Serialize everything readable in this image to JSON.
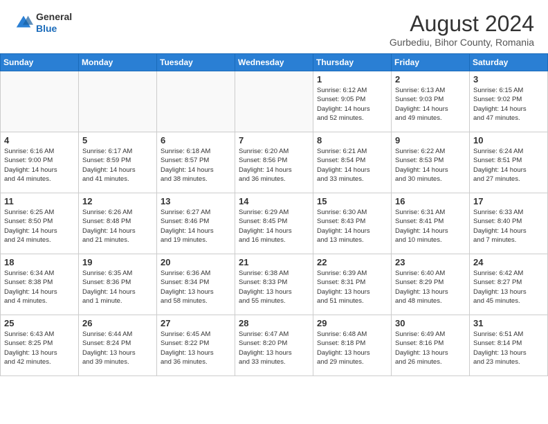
{
  "header": {
    "logo_general": "General",
    "logo_blue": "Blue",
    "month_year": "August 2024",
    "location": "Gurbediu, Bihor County, Romania"
  },
  "weekdays": [
    "Sunday",
    "Monday",
    "Tuesday",
    "Wednesday",
    "Thursday",
    "Friday",
    "Saturday"
  ],
  "weeks": [
    [
      {
        "day": "",
        "info": ""
      },
      {
        "day": "",
        "info": ""
      },
      {
        "day": "",
        "info": ""
      },
      {
        "day": "",
        "info": ""
      },
      {
        "day": "1",
        "info": "Sunrise: 6:12 AM\nSunset: 9:05 PM\nDaylight: 14 hours\nand 52 minutes."
      },
      {
        "day": "2",
        "info": "Sunrise: 6:13 AM\nSunset: 9:03 PM\nDaylight: 14 hours\nand 49 minutes."
      },
      {
        "day": "3",
        "info": "Sunrise: 6:15 AM\nSunset: 9:02 PM\nDaylight: 14 hours\nand 47 minutes."
      }
    ],
    [
      {
        "day": "4",
        "info": "Sunrise: 6:16 AM\nSunset: 9:00 PM\nDaylight: 14 hours\nand 44 minutes."
      },
      {
        "day": "5",
        "info": "Sunrise: 6:17 AM\nSunset: 8:59 PM\nDaylight: 14 hours\nand 41 minutes."
      },
      {
        "day": "6",
        "info": "Sunrise: 6:18 AM\nSunset: 8:57 PM\nDaylight: 14 hours\nand 38 minutes."
      },
      {
        "day": "7",
        "info": "Sunrise: 6:20 AM\nSunset: 8:56 PM\nDaylight: 14 hours\nand 36 minutes."
      },
      {
        "day": "8",
        "info": "Sunrise: 6:21 AM\nSunset: 8:54 PM\nDaylight: 14 hours\nand 33 minutes."
      },
      {
        "day": "9",
        "info": "Sunrise: 6:22 AM\nSunset: 8:53 PM\nDaylight: 14 hours\nand 30 minutes."
      },
      {
        "day": "10",
        "info": "Sunrise: 6:24 AM\nSunset: 8:51 PM\nDaylight: 14 hours\nand 27 minutes."
      }
    ],
    [
      {
        "day": "11",
        "info": "Sunrise: 6:25 AM\nSunset: 8:50 PM\nDaylight: 14 hours\nand 24 minutes."
      },
      {
        "day": "12",
        "info": "Sunrise: 6:26 AM\nSunset: 8:48 PM\nDaylight: 14 hours\nand 21 minutes."
      },
      {
        "day": "13",
        "info": "Sunrise: 6:27 AM\nSunset: 8:46 PM\nDaylight: 14 hours\nand 19 minutes."
      },
      {
        "day": "14",
        "info": "Sunrise: 6:29 AM\nSunset: 8:45 PM\nDaylight: 14 hours\nand 16 minutes."
      },
      {
        "day": "15",
        "info": "Sunrise: 6:30 AM\nSunset: 8:43 PM\nDaylight: 14 hours\nand 13 minutes."
      },
      {
        "day": "16",
        "info": "Sunrise: 6:31 AM\nSunset: 8:41 PM\nDaylight: 14 hours\nand 10 minutes."
      },
      {
        "day": "17",
        "info": "Sunrise: 6:33 AM\nSunset: 8:40 PM\nDaylight: 14 hours\nand 7 minutes."
      }
    ],
    [
      {
        "day": "18",
        "info": "Sunrise: 6:34 AM\nSunset: 8:38 PM\nDaylight: 14 hours\nand 4 minutes."
      },
      {
        "day": "19",
        "info": "Sunrise: 6:35 AM\nSunset: 8:36 PM\nDaylight: 14 hours\nand 1 minute."
      },
      {
        "day": "20",
        "info": "Sunrise: 6:36 AM\nSunset: 8:34 PM\nDaylight: 13 hours\nand 58 minutes."
      },
      {
        "day": "21",
        "info": "Sunrise: 6:38 AM\nSunset: 8:33 PM\nDaylight: 13 hours\nand 55 minutes."
      },
      {
        "day": "22",
        "info": "Sunrise: 6:39 AM\nSunset: 8:31 PM\nDaylight: 13 hours\nand 51 minutes."
      },
      {
        "day": "23",
        "info": "Sunrise: 6:40 AM\nSunset: 8:29 PM\nDaylight: 13 hours\nand 48 minutes."
      },
      {
        "day": "24",
        "info": "Sunrise: 6:42 AM\nSunset: 8:27 PM\nDaylight: 13 hours\nand 45 minutes."
      }
    ],
    [
      {
        "day": "25",
        "info": "Sunrise: 6:43 AM\nSunset: 8:25 PM\nDaylight: 13 hours\nand 42 minutes."
      },
      {
        "day": "26",
        "info": "Sunrise: 6:44 AM\nSunset: 8:24 PM\nDaylight: 13 hours\nand 39 minutes."
      },
      {
        "day": "27",
        "info": "Sunrise: 6:45 AM\nSunset: 8:22 PM\nDaylight: 13 hours\nand 36 minutes."
      },
      {
        "day": "28",
        "info": "Sunrise: 6:47 AM\nSunset: 8:20 PM\nDaylight: 13 hours\nand 33 minutes."
      },
      {
        "day": "29",
        "info": "Sunrise: 6:48 AM\nSunset: 8:18 PM\nDaylight: 13 hours\nand 29 minutes."
      },
      {
        "day": "30",
        "info": "Sunrise: 6:49 AM\nSunset: 8:16 PM\nDaylight: 13 hours\nand 26 minutes."
      },
      {
        "day": "31",
        "info": "Sunrise: 6:51 AM\nSunset: 8:14 PM\nDaylight: 13 hours\nand 23 minutes."
      }
    ]
  ]
}
